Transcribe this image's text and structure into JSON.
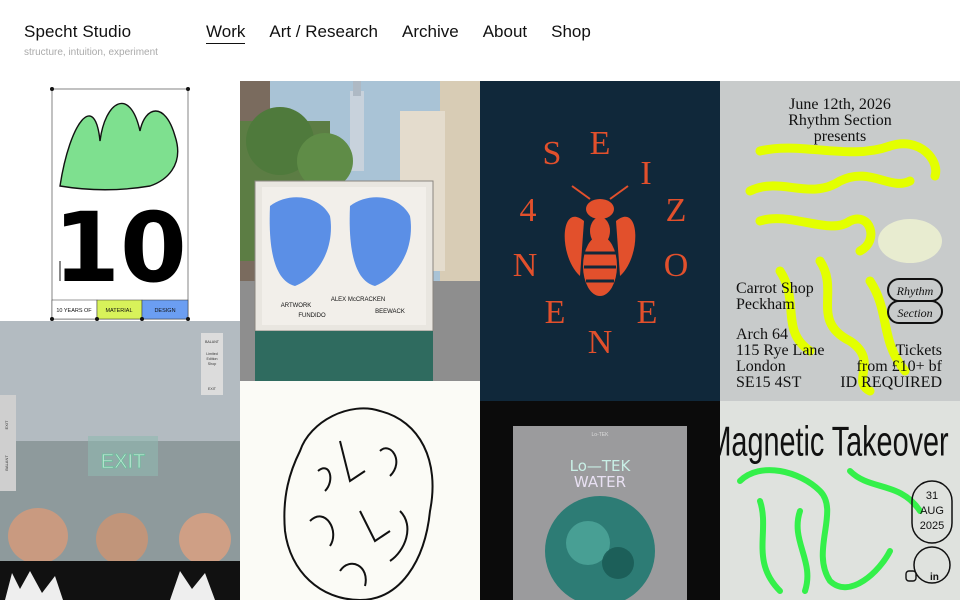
{
  "site": {
    "name": "Specht Studio",
    "tagline": "structure, intuition, experiment"
  },
  "nav": [
    {
      "label": "Work",
      "active": true
    },
    {
      "label": "Art / Research",
      "active": false
    },
    {
      "label": "Archive",
      "active": false
    },
    {
      "label": "About",
      "active": false
    },
    {
      "label": "Shop",
      "active": false
    }
  ],
  "tiles": {
    "material": {
      "number": "10",
      "cells": [
        "10 YEARS OF",
        "MATERIAL",
        "DESIGN"
      ],
      "colors": [
        "#7ee08f",
        "#d8f25a",
        "#6b9ef2"
      ]
    },
    "poster_street": {
      "line1": "ARTWORK",
      "line2": "ALEX McCRACKEN",
      "line3": "FUNDIDO",
      "line4": "BEEWACK"
    },
    "seize": {
      "letters": [
        "S",
        "E",
        "I",
        "Z",
        "O",
        "E",
        "N",
        "E",
        "N",
        "4"
      ],
      "bg": "#10283a",
      "ink": "#e2502c"
    },
    "rhythm": {
      "date": "June 12th, 2026",
      "org": "Rhythm Section",
      "presents": "presents",
      "badge1": "Rhythm",
      "badge2": "Section",
      "venue1": "Carrot Shop",
      "venue2": "Peckham",
      "addr1": "Arch 64",
      "addr2": "115 Rye Lane",
      "addr3": "London",
      "addr4": "SE15 4ST",
      "tickets1": "Tickets",
      "tickets2": "from £10+ bf",
      "tickets3": "ID REQUIRED"
    },
    "exit": {
      "sign": "EXIT",
      "card_lines": [
        "BALANT",
        "Limited",
        "Edition",
        "Shop",
        "EXIT"
      ],
      "side": [
        "EXIT",
        "BALANT"
      ]
    },
    "water": {
      "small": "Lo-TEK",
      "title1": "Lo—TEK",
      "title2": "WATER"
    },
    "magnetic": {
      "title": "Magnetic Takeover",
      "day": "31",
      "month": "AUG",
      "year": "2025",
      "icons": [
        "instagram-icon",
        "linkedin-icon"
      ]
    }
  }
}
